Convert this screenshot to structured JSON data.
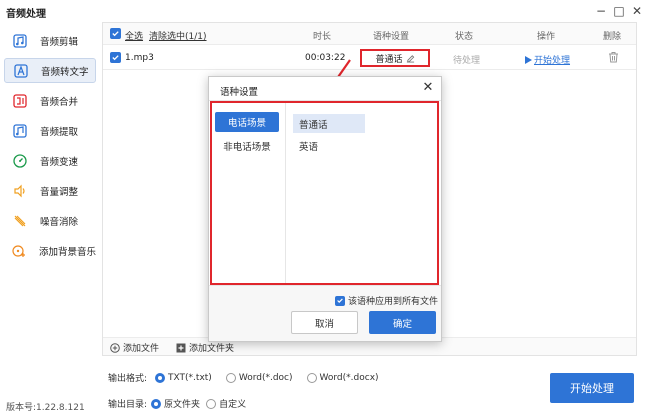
{
  "app": {
    "title": "音频处理",
    "window_controls": {
      "minimize": "−",
      "maximize": "□",
      "close": "✕"
    },
    "version": "版本号:1.22.8.121"
  },
  "sidebar": {
    "items": [
      {
        "label": "音频剪辑",
        "icon": "audio-cut-icon",
        "active": false
      },
      {
        "label": "音频转文字",
        "icon": "audio-to-text-icon",
        "active": true
      },
      {
        "label": "音频合并",
        "icon": "audio-merge-icon",
        "active": false
      },
      {
        "label": "音频提取",
        "icon": "audio-extract-icon",
        "active": false
      },
      {
        "label": "音频变速",
        "icon": "audio-speed-icon",
        "active": false
      },
      {
        "label": "音量调整",
        "icon": "volume-icon",
        "active": false
      },
      {
        "label": "噪音消除",
        "icon": "noise-removal-icon",
        "active": false
      },
      {
        "label": "添加背景音乐",
        "icon": "add-music-icon",
        "active": false
      }
    ]
  },
  "table": {
    "select_all": "全选",
    "clear_selected": "清除选中(1/1)",
    "columns": {
      "duration": "时长",
      "language": "语种设置",
      "status": "状态",
      "action": "操作",
      "delete": "删除"
    },
    "rows": [
      {
        "name": "1.mp3",
        "duration": "00:03:22",
        "language": "普通话",
        "status": "待处理",
        "action": "开始处理"
      }
    ],
    "add_file": "添加文件",
    "add_folder": "添加文件夹"
  },
  "output": {
    "format_label": "输出格式:",
    "formats": [
      "TXT(*.txt)",
      "Word(*.doc)",
      "Word(*.docx)"
    ],
    "selected_format": 0,
    "dir_label": "输出目录:",
    "dirs": [
      "原文件夹",
      "自定义"
    ],
    "selected_dir": 0,
    "start_button": "开始处理"
  },
  "dialog": {
    "title": "语种设置",
    "close": "✕",
    "scenes": [
      "电话场景",
      "非电话场景"
    ],
    "active_scene": 0,
    "languages": [
      "普通话",
      "英语"
    ],
    "active_language": 0,
    "apply_all": "该语种应用到所有文件",
    "cancel": "取消",
    "ok": "确定"
  },
  "colors": {
    "accent": "#2e74d6",
    "highlight": "#e0262c"
  }
}
